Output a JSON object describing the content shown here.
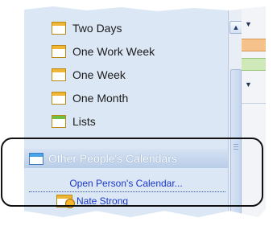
{
  "nav": {
    "items": [
      {
        "label": "Two Days",
        "icon": "calendar-icon"
      },
      {
        "label": "One Work Week",
        "icon": "calendar-icon"
      },
      {
        "label": "One Week",
        "icon": "calendar-icon"
      },
      {
        "label": "One Month",
        "icon": "calendar-icon"
      },
      {
        "label": "Lists",
        "icon": "list-icon"
      }
    ]
  },
  "section": {
    "title": "Other People's Calendars",
    "icon": "calendar-group-icon"
  },
  "actions": {
    "open_person_calendar": "Open Person's Calendar..."
  },
  "people": [
    {
      "name": "Nate Strong",
      "icon": "person-calendar-icon"
    }
  ],
  "colors": {
    "pane_background": "#dce7f5",
    "link": "#1a37c9",
    "section_header": "#b9cde8",
    "highlight_border": "#111111"
  }
}
